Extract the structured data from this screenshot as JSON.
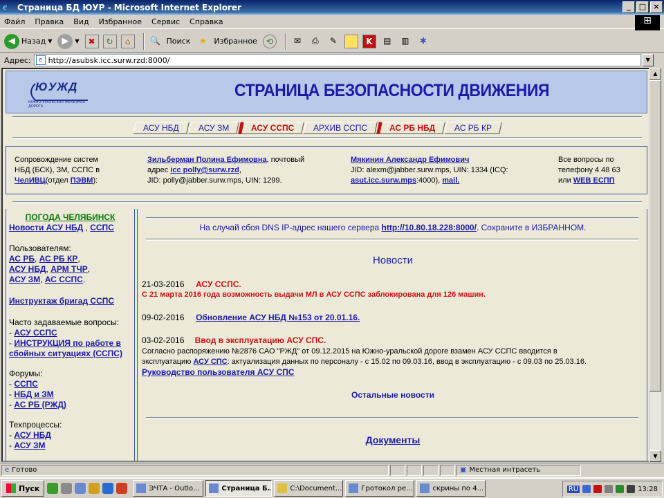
{
  "window": {
    "title": "Страница БД ЮУР - Microsoft Internet Explorer"
  },
  "menu": [
    "Файл",
    "Правка",
    "Вид",
    "Избранное",
    "Сервис",
    "Справка"
  ],
  "toolbar": {
    "back": "Назад",
    "search": "Поиск",
    "favorites": "Избранное"
  },
  "address": {
    "label": "Адрес:",
    "url": "http://asubsk.icc.surw.rzd:8000/"
  },
  "page": {
    "logo_text": "ЮУЖД",
    "logo_sub": "ЮЖНО-УРАЛЬСКАЯ ЖЕЛЕЗНАЯ ДОРОГА",
    "title": "СТРАНИЦА БЕЗОПАСНОСТИ ДВИЖЕНИЯ",
    "tabs": [
      "АСУ НБД",
      "АСУ ЗМ",
      "АСУ ССПС",
      "АРХИВ ССПС",
      "АС РБ НБД",
      "АС РБ КР"
    ],
    "info": {
      "c1_l1": "Сопровождение систем",
      "c1_l2": "НБД (БСК), ЗМ, ССПС в",
      "c1_link1": "ЧелИВЦ",
      "c1_mid": "(отдел ",
      "c1_link2": "ПЭВМ",
      "c1_end": "):",
      "c2_name": "Зильберман Полина Ефимовна",
      "c2_after": ", почтовый",
      "c2_l2a": "адрес ",
      "c2_email": "icc polly@surw.rzd",
      "c2_l2b": ",",
      "c2_l3": "JID: polly@jabber.surw.mps, UIN: 1299.",
      "c3_name": "Мякинин Александр Ефимович",
      "c3_l2": "JID: alexm@jabber.surw.mps, UIN: 1334 (ICQ:",
      "c3_link": "asut.icc.surw.mps",
      "c3_l3b": ":4000), ",
      "c3_mail": "mail.",
      "c4_l1": "Все вопросы по",
      "c4_l2": "телефону 4 48 63",
      "c4_l3a": "или ",
      "c4_link": "WEB ЕСПП"
    },
    "sidebar": {
      "weather": "ПОГОДА ЧЕЛЯБИНСК",
      "news_link": "Новости АСУ НБД",
      "news_comma": " ,   ",
      "sspc_link": "ССПС",
      "users_label": "Пользователям:",
      "u1": "АС РБ",
      "u2": "АС РБ КР",
      "u3": "АСУ НБД",
      "u4": "АРМ ТЧР",
      "u5": "АСУ ЗМ",
      "u6": "АС ССПС",
      "instr": "Инструктаж бригад ССПС",
      "faq_label": "Часто задаваемые вопросы:",
      "faq1": "АСУ ССПС",
      "faq2a": "ИНСТРУКЦИЯ по работе в",
      "faq2b": "сбойных ситуациях (ССПС)",
      "forums_label": "Форумы:",
      "f1": "ССПС",
      "f2": "НБД и ЗМ",
      "f3": "АС РБ (РЖД)",
      "tech_label": "Техпроцессы:",
      "t1": "АСУ НБД",
      "t2": "АСУ ЗМ"
    },
    "main": {
      "dns_pre": "На случай сбоя DNS IP-адрес нашего сервера ",
      "dns_link": "http://10.80.18.228:8000/",
      "dns_post": ". Сохраните в ИЗБРАННОМ.",
      "news_title": "Новости",
      "n1_date": "21-03-2016",
      "n1_title": "АСУ ССПС.",
      "n1_text": "С 21 марта 2016 года возможность выдачи МЛ в АСУ ССПС заблокирована для 126 машин.",
      "n2_date": "09-02-2016",
      "n2_link": "Обновление АСУ НБД №153 от 20.01.16.",
      "n3_date": "03-02-2016",
      "n3_title": "Ввод в эксплуатацию АСУ СПС.",
      "n3_l1": "Согласно распоряжению №2876 САО \"РЖД\" от 09.12.2015 на Южно-уральской дороге взамен АСУ ССПС вводится в",
      "n3_l2a": "эксплуатацию ",
      "n3_l2link": "АСУ СПС",
      "n3_l2b": ": актуализация данных по персоналу - с 15.02 по 09.03.16, ввод в эксплуатацию - с 09.03 по 25.03.16.",
      "n3_guide": "Руководство пользователя АСУ СПС",
      "other_news": "Остальные новости",
      "docs": "Документы"
    }
  },
  "status": {
    "text": "Готово",
    "zone": "Местная интрасеть"
  },
  "taskbar": {
    "start": "Пуск",
    "tasks": [
      "ЭЧТА - Outlo...",
      "Страница Б...",
      "C:\\Document...",
      "Гротокол ре...",
      "скрины по 4..."
    ],
    "lang": "RU",
    "clock": "13:28"
  }
}
